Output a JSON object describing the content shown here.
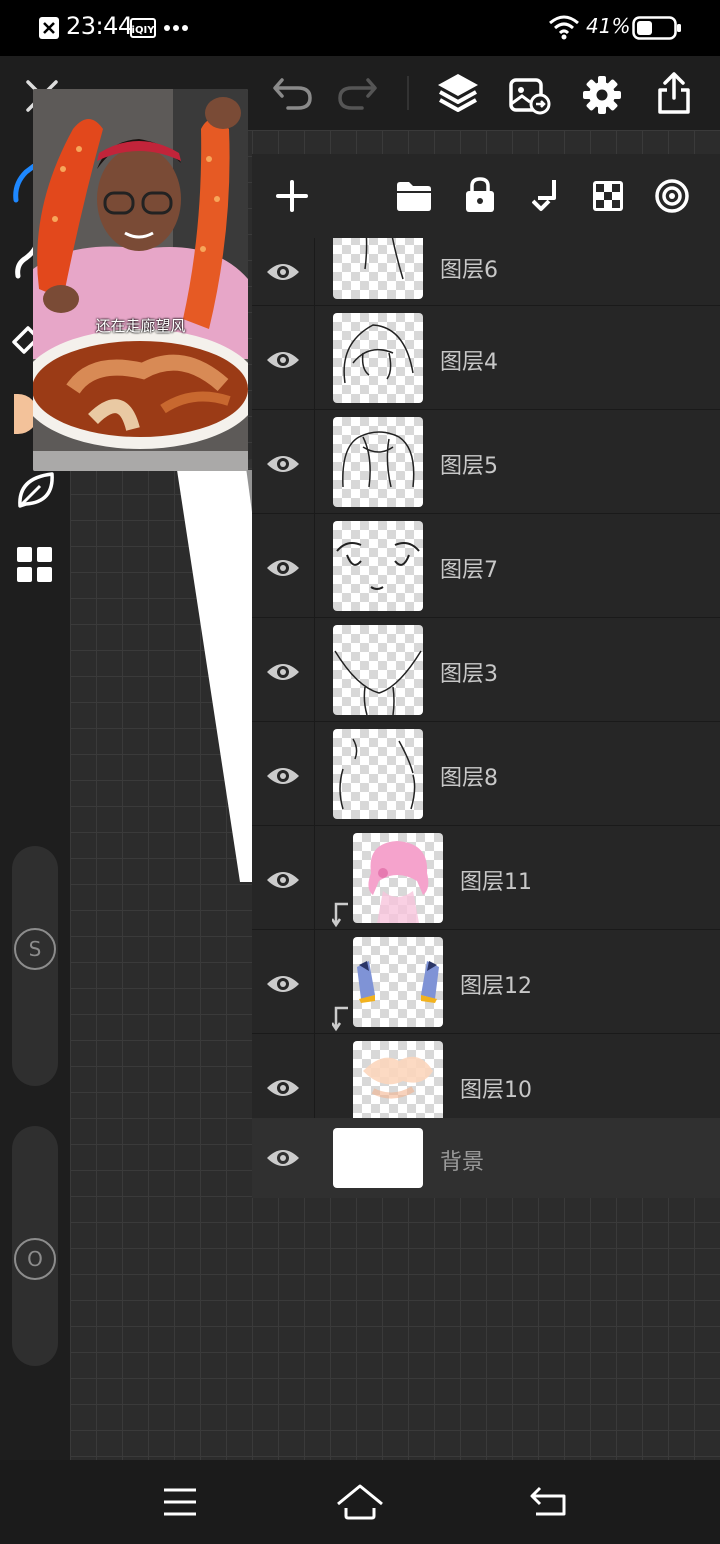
{
  "status_bar": {
    "time": "23:44",
    "icons": [
      "close-badge-icon",
      "iqiyi-icon",
      "more-dots-icon",
      "wifi-icon",
      "battery-icon"
    ],
    "battery_percent": "41%"
  },
  "top_bar": {
    "icons": [
      "close-icon",
      "undo-icon",
      "redo-icon",
      "layers-icon",
      "gallery-import-icon",
      "settings-gear-icon",
      "share-export-icon"
    ]
  },
  "left_rail": {
    "tools": [
      "brush-icon",
      "smudge-icon",
      "eraser-icon",
      "color-swatch",
      "leaf-icon",
      "grid-icon"
    ],
    "size_slider_label": "S",
    "opacity_slider_label": "O"
  },
  "video_popup": {
    "caption": "还在走廊望风",
    "subject": "woman-holding-crab-legs"
  },
  "layers_panel": {
    "toolbar_icons": [
      "add-layer-icon",
      "folder-icon",
      "lock-icon",
      "merge-down-icon",
      "alpha-lock-icon",
      "reference-icon"
    ],
    "layers": [
      {
        "name": "图层6",
        "thumb": "sketch-torso",
        "clipped": false
      },
      {
        "name": "图层4",
        "thumb": "sketch-hair",
        "clipped": false
      },
      {
        "name": "图层5",
        "thumb": "sketch-scarf",
        "clipped": false
      },
      {
        "name": "图层7",
        "thumb": "sketch-eyes",
        "clipped": false
      },
      {
        "name": "图层3",
        "thumb": "sketch-face",
        "clipped": false
      },
      {
        "name": "图层8",
        "thumb": "sketch-shoulders",
        "clipped": false
      },
      {
        "name": "图层11",
        "thumb": "pink-hair-color",
        "clipped": true
      },
      {
        "name": "图层12",
        "thumb": "blue-sleeves-color",
        "clipped": true
      },
      {
        "name": "图层10",
        "thumb": "skin-color",
        "clipped": false
      }
    ],
    "background_layer": {
      "name": "背景"
    }
  },
  "colors": {
    "app_bg": "#1e1e1e",
    "panel_bg": "#262626",
    "accent_blue": "#1e88ff",
    "swatch": "#f3c29a"
  },
  "bottom_nav": {
    "icons": [
      "menu-icon",
      "home-icon",
      "back-icon"
    ]
  }
}
